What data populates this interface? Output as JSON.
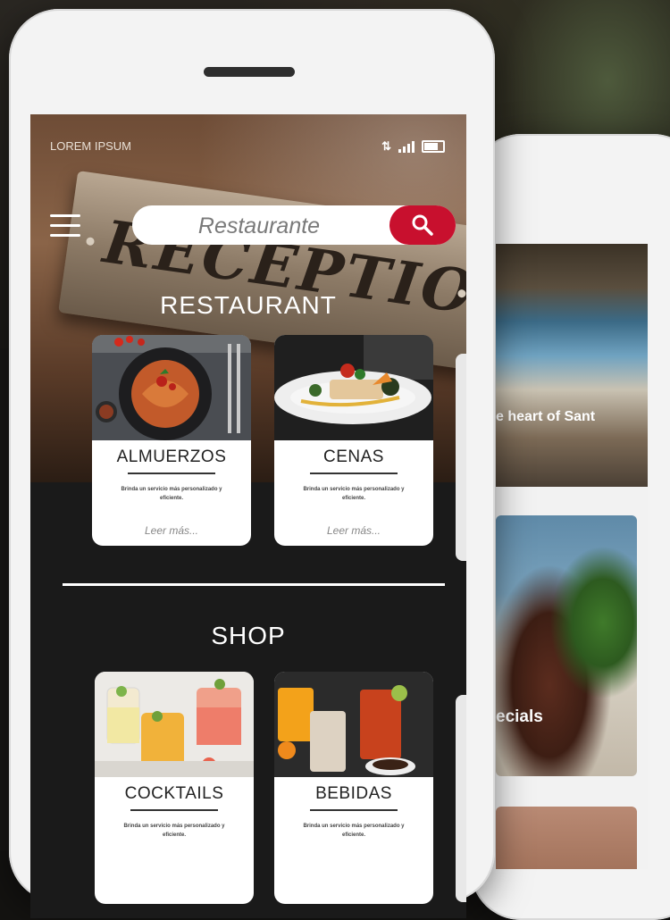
{
  "status_bar": {
    "brand": "LOREM IPSUM"
  },
  "search": {
    "placeholder": "Restaurante"
  },
  "sections": {
    "restaurant": "RESTAURANT",
    "shop": "SHOP"
  },
  "restaurant_cards": [
    {
      "title": "ALMUERZOS",
      "desc": "Brinda un servicio más personalizado y eficiente.",
      "more": "Leer más..."
    },
    {
      "title": "CENAS",
      "desc": "Brinda un servicio más personalizado y eficiente.",
      "more": "Leer más..."
    }
  ],
  "shop_cards": [
    {
      "title": "COCKTAILS",
      "desc": "Brinda un servicio más personalizado y eficiente."
    },
    {
      "title": "BEBIDAS",
      "desc": "Brinda un servicio más personalizado y eficiente."
    }
  ],
  "hero": {
    "sign_text": "RECEPTION"
  },
  "back_phone": {
    "hero_caption": "e heart of Sant",
    "card_caption": "ecials"
  },
  "colors": {
    "accent": "#c8102e",
    "dark_bg": "#1a1a1a"
  }
}
